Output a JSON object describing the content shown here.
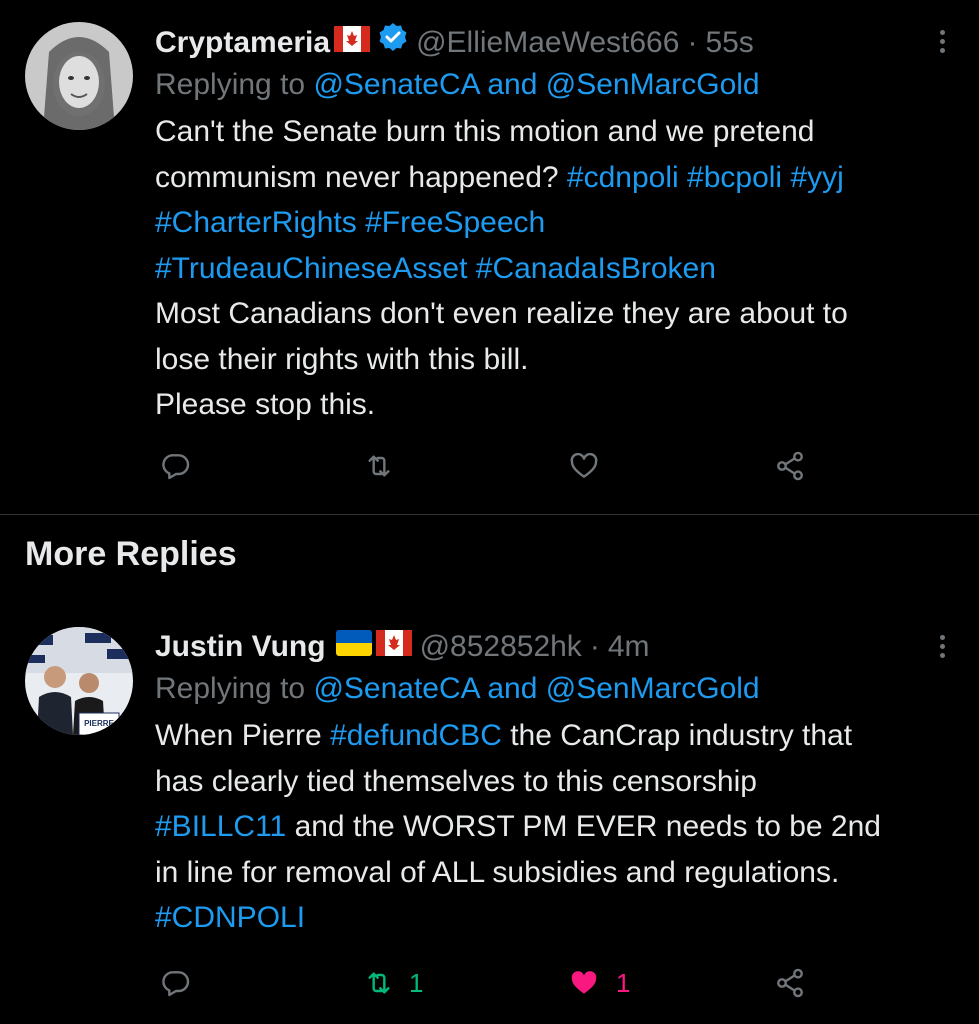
{
  "tweets": [
    {
      "name": "Cryptameria",
      "handle": "@EllieMaeWest666",
      "sep": "·",
      "time": "55s",
      "reply_prefix": "Replying to",
      "mention1": "@SenateCA",
      "reply_and": "and",
      "mention2": "@SenMarcGold",
      "body": {
        "l1": "Can't the Senate burn this motion and we pretend",
        "l2_text": "communism never happened?",
        "l2_tags": [
          "#cdnpoli",
          "#bcpoli",
          "#yyj"
        ],
        "l3_tags": [
          "#CharterRights",
          "#FreeSpeech"
        ],
        "l4_tags": [
          "#TrudeauChineseAsset",
          "#CanadaIsBroken"
        ],
        "l5": "Most Canadians don't even realize they are about to",
        "l6": "lose their rights with this bill.",
        "l7": "Please stop this."
      },
      "verified": true,
      "flags": [
        "canada-flag"
      ]
    },
    {
      "name": "Justin Vung",
      "handle": "@852852hk",
      "sep": "·",
      "time": "4m",
      "reply_prefix": "Replying to",
      "mention1": "@SenateCA",
      "reply_and": "and",
      "mention2": "@SenMarcGold",
      "body": {
        "l1_a": "When Pierre",
        "l1_tag": "#defundCBC",
        "l1_b": "the CanCrap industry that",
        "l2": "has clearly tied themselves to this censorship",
        "l3_tag": "#BILLC11",
        "l3_b": "and the WORST PM EVER needs to be 2nd",
        "l4": "in line for removal of ALL subsidies and regulations.",
        "l5_tag": "#CDNPOLI"
      },
      "retweet_count": "1",
      "like_count": "1",
      "avatar_sign": "PIERRE",
      "flags": [
        "ukraine-flag",
        "canada-flag"
      ]
    }
  ],
  "section_title": "More Replies",
  "colors": {
    "accent": "#1d9bf0",
    "muted": "#71767b",
    "retweet": "#00ba7c",
    "like": "#f91880"
  }
}
